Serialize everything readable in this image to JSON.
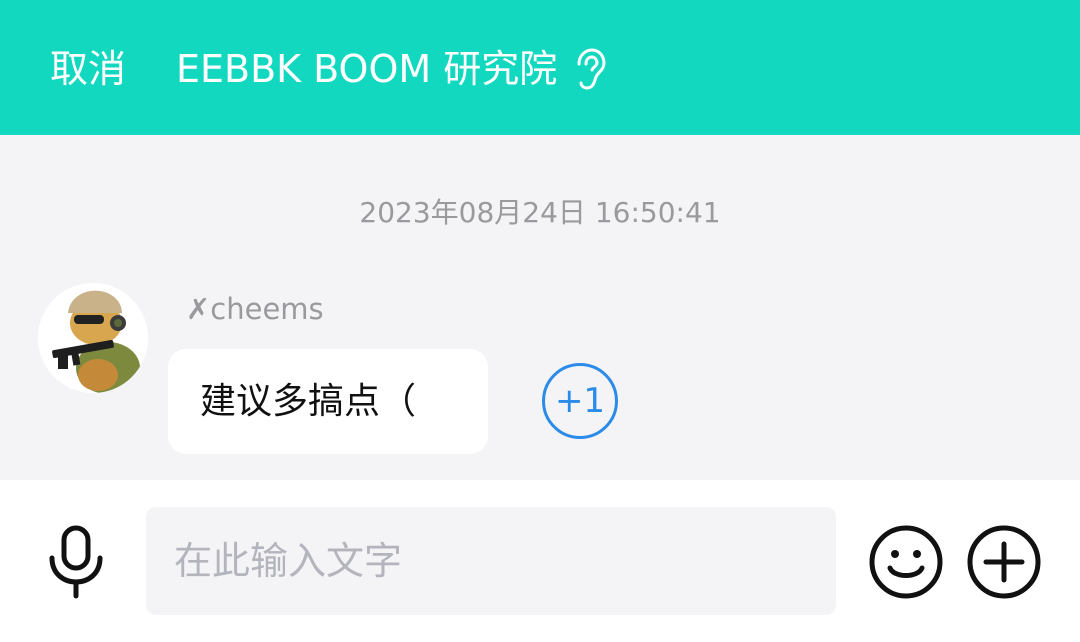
{
  "header": {
    "cancel_label": "取消",
    "title": "EEBBK BOOM 研究院",
    "ear_icon": "ear-icon",
    "background": "#12d8c0"
  },
  "chat": {
    "timestamp": "2023年08月24日 16:50:41",
    "messages": [
      {
        "sender": "✗cheems",
        "avatar_icon": "avatar-image",
        "text": "建议多搞点（",
        "reaction_label": "+1"
      }
    ]
  },
  "composer": {
    "mic_icon": "microphone-icon",
    "input_placeholder": "在此输入文字",
    "input_value": "",
    "emoji_icon": "smiley-icon",
    "plus_icon": "plus-circle-icon"
  },
  "colors": {
    "accent": "#12d8c0",
    "reaction": "#2a8be8",
    "meta_text": "#9a9a9e"
  }
}
